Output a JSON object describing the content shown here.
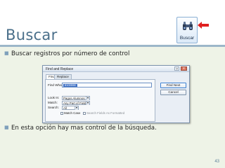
{
  "slide": {
    "title": "Buscar",
    "bullets": [
      "Buscar registros por  número de control",
      "En esta opción hay mas control de la búsqueda."
    ],
    "page_number": "43",
    "bullet_color": "#7fa0bb",
    "title_color": "#4a6f8a",
    "band_color": "#eef3e7"
  },
  "ribbon": {
    "button_label": "Buscar",
    "icon": "binoculars-icon",
    "arrow_color": "#e02020"
  },
  "dialog": {
    "title": "Find and Replace",
    "help_label": "?",
    "close_label": "x",
    "tabs": [
      "Find",
      "Replace"
    ],
    "active_tab": "Find",
    "find_what_label": "Find What:",
    "find_what_value": "8100598",
    "look_in_label": "Look In:",
    "look_in_value": "Pagos Alumnos",
    "match_label": "Match:",
    "match_value": "Any Part of Field",
    "search_label": "Search:",
    "search_value": "All",
    "match_case_label": "Match Case",
    "search_formatted_label": "Search Fields As Formatted",
    "find_next_label": "Find Next",
    "cancel_label": "Cancel"
  }
}
